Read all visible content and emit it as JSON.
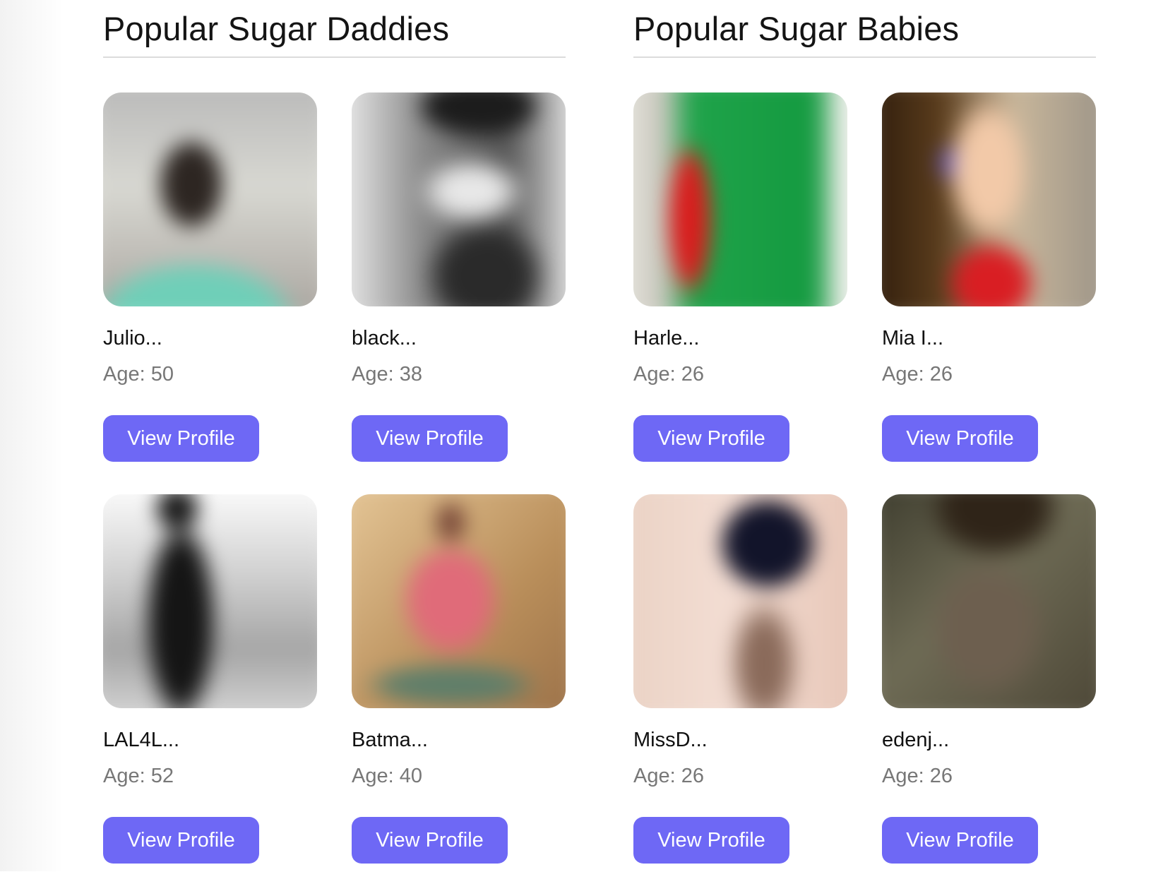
{
  "sections": [
    {
      "title": "Popular Sugar Daddies",
      "profiles": [
        {
          "name": "Julio...",
          "age": "Age: 50",
          "button": "View Profile"
        },
        {
          "name": "black...",
          "age": "Age: 38",
          "button": "View Profile"
        },
        {
          "name": "LAL4L...",
          "age": "Age: 52",
          "button": "View Profile"
        },
        {
          "name": "Batma...",
          "age": "Age: 40",
          "button": "View Profile"
        }
      ]
    },
    {
      "title": "Popular Sugar Babies",
      "profiles": [
        {
          "name": "Harle...",
          "age": "Age: 26",
          "button": "View Profile"
        },
        {
          "name": "Mia I...",
          "age": "Age: 26",
          "button": "View Profile"
        },
        {
          "name": "MissD...",
          "age": "Age: 26",
          "button": "View Profile"
        },
        {
          "name": "edenj...",
          "age": "Age: 26",
          "button": "View Profile"
        }
      ]
    }
  ],
  "colors": {
    "button_bg": "#6e68f5",
    "button_text": "#ffffff",
    "name_text": "#111111",
    "age_text": "#777777"
  }
}
